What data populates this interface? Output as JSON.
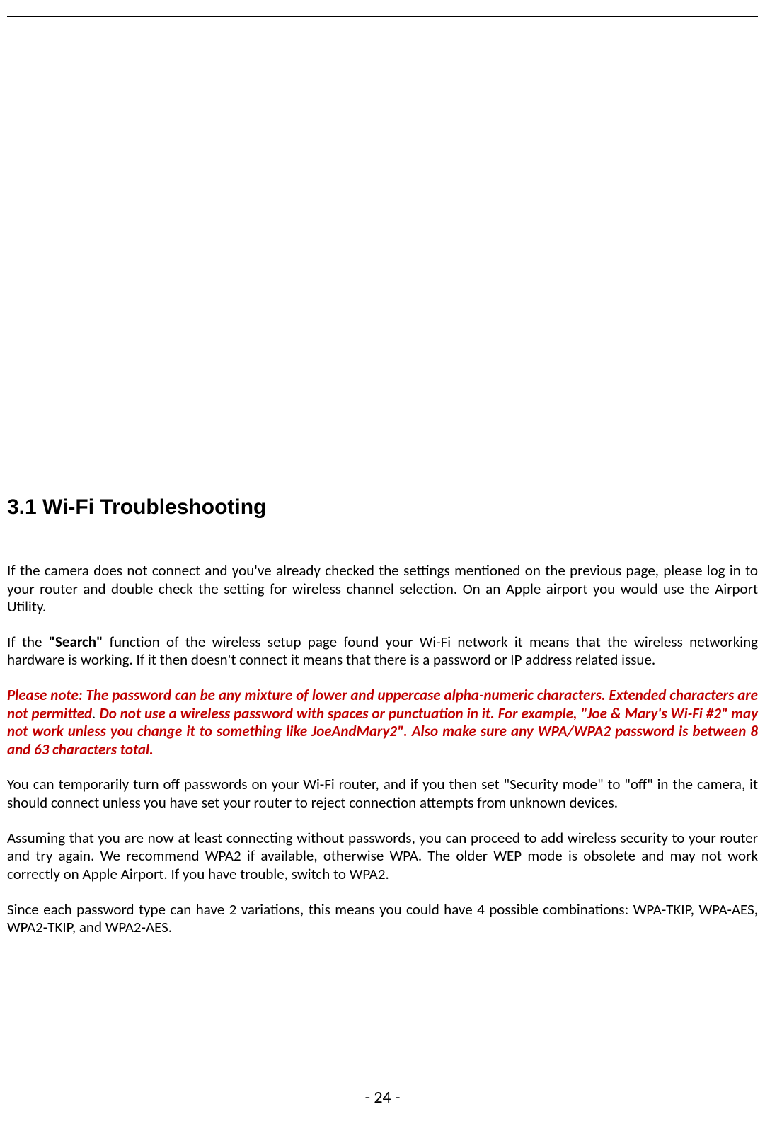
{
  "heading": "3.1 Wi-Fi Troubleshooting",
  "p1": "If the camera does not connect and you've already checked the settings mentioned on the previous page, please log in to your router and double check the setting for wireless channel selection. On an Apple airport you would use the Airport Utility.",
  "p2a": "If the ",
  "p2b": "\"Search\"",
  "p2c": " function of the wireless setup page found your Wi-Fi network it means that the wireless networking hardware is working. If it then doesn't connect it means that there is a password or IP address related issue.",
  "note1": "Please note: The password can be any mixture of lower and uppercase alpha-numeric characters. Extended characters are not permitted",
  "note_dot": ". ",
  "note2": "Do not use a wireless password with spaces or punctuation in it. For example, \"Joe & Mary's Wi-Fi #2\" may not work unless you change it to something like JoeAndMary2\". Also make sure any WPA/WPA2 password is between 8 and 63 characters total.",
  "p3": "You can temporarily turn off passwords on your Wi-Fi router, and if you then set \"Security mode\" to \"off\" in the camera, it should connect unless you have set your router to reject connection attempts from unknown devices.",
  "p4": "Assuming that you are now at least connecting without passwords, you can proceed to add wireless security to your router and try again. We recommend WPA2 if available, otherwise WPA. The older WEP mode is obsolete and may not work correctly on Apple Airport. If you have trouble, switch to WPA2.",
  "p5": "Since each password type can have 2 variations, this means you could have 4 possible combinations: WPA-TKIP, WPA-AES, WPA2-TKIP, and WPA2-AES.",
  "page_number": "- 24 -"
}
